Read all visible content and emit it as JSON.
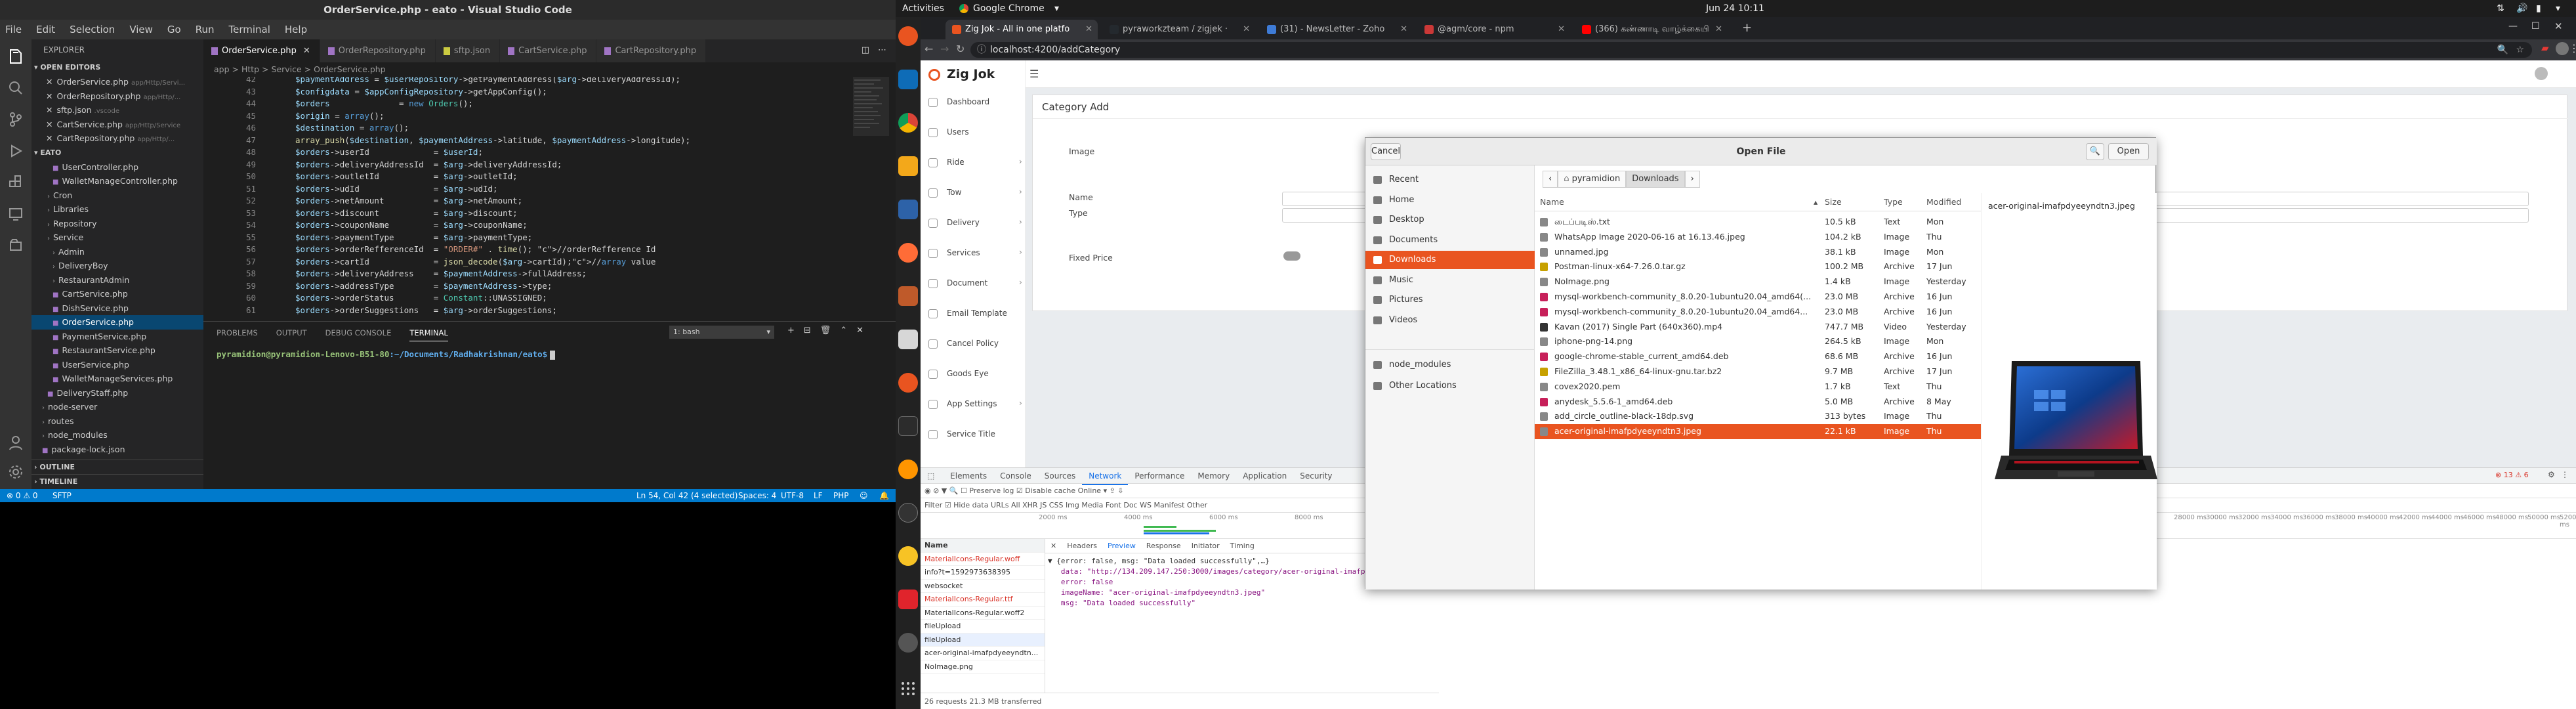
{
  "vscode": {
    "title": "OrderService.php - eato - Visual Studio Code",
    "menu": [
      "File",
      "Edit",
      "Selection",
      "View",
      "Go",
      "Run",
      "Terminal",
      "Help"
    ],
    "explorer_title": "EXPLORER",
    "open_editors_label": "OPEN EDITORS",
    "open_editors": [
      {
        "name": "OrderService.php",
        "path": "app/Http/Servi..."
      },
      {
        "name": "OrderRepository.php",
        "path": "app/Http/..."
      },
      {
        "name": "sftp.json",
        "path": ".vscode"
      },
      {
        "name": "CartService.php",
        "path": "app/Http/Service"
      },
      {
        "name": "CartRepository.php",
        "path": "app/Http/..."
      }
    ],
    "project_label": "EATO",
    "tree": [
      {
        "name": "UserController.php",
        "depth": 3
      },
      {
        "name": "WalletManageController.php",
        "depth": 3
      },
      {
        "name": "Cron",
        "depth": 2
      },
      {
        "name": "Libraries",
        "depth": 2
      },
      {
        "name": "Repository",
        "depth": 2
      },
      {
        "name": "Service",
        "depth": 2
      },
      {
        "name": "Admin",
        "depth": 3
      },
      {
        "name": "DeliveryBoy",
        "depth": 3
      },
      {
        "name": "RestaurantAdmin",
        "depth": 3
      },
      {
        "name": "CartService.php",
        "depth": 3
      },
      {
        "name": "DishService.php",
        "depth": 3
      },
      {
        "name": "OrderService.php",
        "depth": 3,
        "selected": true
      },
      {
        "name": "PaymentService.php",
        "depth": 3
      },
      {
        "name": "RestaurantService.php",
        "depth": 3
      },
      {
        "name": "UserService.php",
        "depth": 3
      },
      {
        "name": "WalletManageServices.php",
        "depth": 3
      },
      {
        "name": "DeliveryStaff.php",
        "depth": 2
      },
      {
        "name": "node-server",
        "depth": 1
      },
      {
        "name": "routes",
        "depth": 1
      },
      {
        "name": "node_modules",
        "depth": 1
      },
      {
        "name": "package-lock.json",
        "depth": 1
      }
    ],
    "outline_label": "OUTLINE",
    "timeline_label": "TIMELINE",
    "tabs": [
      "OrderService.php",
      "OrderRepository.php",
      "sftp.json",
      "CartService.php",
      "CartRepository.php"
    ],
    "breadcrumb": "app > Http > Service > OrderService.php",
    "code_lines": [
      {
        "n": "42",
        "t": "$paymentAddress = $userRepository->getPaymentAddress($arg->deliveryAddressId);"
      },
      {
        "n": "43",
        "t": "$configdata = $appConfigRepository->getAppConfig();"
      },
      {
        "n": "44",
        "t": "$orders              = new Orders();"
      },
      {
        "n": "45",
        "t": "$origin = array();"
      },
      {
        "n": "46",
        "t": "$destination = array();"
      },
      {
        "n": "47",
        "t": "array_push($destination, $paymentAddress->latitude, $paymentAddress->longitude);"
      },
      {
        "n": "48",
        "t": "$orders->userId             = $userId;"
      },
      {
        "n": "49",
        "t": "$orders->deliveryAddressId  = $arg->deliveryAddressId;"
      },
      {
        "n": "50",
        "t": "$orders->outletId           = $arg->outletId;"
      },
      {
        "n": "51",
        "t": "$orders->udId               = $arg->udId;"
      },
      {
        "n": "52",
        "t": "$orders->netAmount          = $arg->netAmount;"
      },
      {
        "n": "53",
        "t": "$orders->discount           = $arg->discount;"
      },
      {
        "n": "54",
        "t": "$orders->couponName         = $arg->couponName;"
      },
      {
        "n": "55",
        "t": "$orders->paymentType        = $arg->paymentType;"
      },
      {
        "n": "56",
        "t": "$orders->orderRefferenceId  = \"ORDER#\" . time(); //orderRefference Id"
      },
      {
        "n": "57",
        "t": "$orders->cartId             = json_decode($arg->cartId);//array value"
      },
      {
        "n": "58",
        "t": "$orders->deliveryAddress    = $paymentAddress->fullAddress;"
      },
      {
        "n": "59",
        "t": "$orders->addressType        = $paymentAddress->type;"
      },
      {
        "n": "60",
        "t": "$orders->orderStatus        = Constant::UNASSIGNED;"
      },
      {
        "n": "61",
        "t": "$orders->orderSuggestions   = $arg->orderSuggestions;"
      }
    ],
    "panel_tabs": [
      "PROBLEMS",
      "OUTPUT",
      "DEBUG CONSOLE",
      "TERMINAL"
    ],
    "terminal_select": "1: bash",
    "terminal_prompt_user": "pyramidion@pyramidion-Lenovo-B51-80",
    "terminal_prompt_path": ":~/Documents/Radhakrishnan/eato$",
    "status_left": [
      "⊗ 0 ⚠ 0",
      "SFTP"
    ],
    "status_right": [
      "Ln 54, Col 42 (4 selected)",
      "Spaces: 4",
      "UTF-8",
      "LF",
      "PHP"
    ]
  },
  "system": {
    "activities": "Activities",
    "app_name": "Google Chrome",
    "clock": "Jun 24  10:11"
  },
  "chrome": {
    "tabs": [
      {
        "title": "Zig Jok - All in one platfo",
        "color": "#e95420",
        "active": true
      },
      {
        "title": "pyraworkzteam / zigjek ·",
        "color": "#24292e"
      },
      {
        "title": "(31) - NewsLetter - Zoho",
        "color": "#3e7bd6"
      },
      {
        "title": "@agm/core - npm",
        "color": "#cb3837"
      },
      {
        "title": "(366) கண்ணாடி வாழ்க்கையி",
        "color": "#ff0000"
      }
    ],
    "url": "localhost:4200/addCategory"
  },
  "app": {
    "logo": "Zig Jok",
    "nav": [
      {
        "label": "Dashboard",
        "chev": false
      },
      {
        "label": "Users",
        "chev": false
      },
      {
        "label": "Ride",
        "chev": true
      },
      {
        "label": "Tow",
        "chev": true
      },
      {
        "label": "Delivery",
        "chev": true
      },
      {
        "label": "Services",
        "chev": true
      },
      {
        "label": "Document",
        "chev": true
      },
      {
        "label": "Email Template",
        "chev": false
      },
      {
        "label": "Cancel Policy",
        "chev": false
      },
      {
        "label": "Goods Eye",
        "chev": false
      },
      {
        "label": "App Settings",
        "chev": true
      },
      {
        "label": "Service Title",
        "chev": false
      }
    ],
    "card_title": "Category Add",
    "labels": [
      "Image",
      "Name",
      "Type",
      "Fixed Price"
    ]
  },
  "devtools": {
    "tabs": [
      "Elements",
      "Console",
      "Sources",
      "Network",
      "Performance",
      "Memory",
      "Application",
      "Security"
    ],
    "toolbar": "◉  ⊘  ▼  🔍   ☐ Preserve log   ☑ Disable cache   Online ▾   ⇪  ⇩",
    "filter": "Filter          ☑ Hide data URLs   All  XHR  JS  CSS  Img  Media  Font  Doc  WS  Manifest  Other",
    "timeline_ticks": [
      "2000 ms",
      "4000 ms",
      "6000 ms",
      "8000 ms",
      "10000 ms"
    ],
    "timeline_ticks_right": [
      "28000 ms",
      "30000 ms",
      "32000 ms",
      "34000 ms",
      "36000 ms",
      "38000 ms",
      "40000 ms",
      "42000 ms",
      "44000 ms",
      "46000 ms",
      "48000 ms",
      "50000 ms",
      "52000 ms"
    ],
    "names_header": "Name",
    "names": [
      {
        "n": "MaterialIcons-Regular.woff",
        "red": true
      },
      {
        "n": "info?t=1592973638395",
        "red": false
      },
      {
        "n": "websocket",
        "red": false
      },
      {
        "n": "MaterialIcons-Regular.ttf",
        "red": true
      },
      {
        "n": "MaterialIcons-Regular.woff2",
        "red": false
      },
      {
        "n": "fileUpload",
        "red": false
      },
      {
        "n": "fileUpload",
        "red": false,
        "sel": true
      },
      {
        "n": "acer-original-imafpdyeeyndtn...",
        "red": false
      },
      {
        "n": "NoImage.png",
        "red": false
      }
    ],
    "detail_tabs": [
      "Headers",
      "Preview",
      "Response",
      "Initiator",
      "Timing"
    ],
    "json_lines": [
      "▼ {error: false, msg: \"Data loaded successfully\",…}",
      "   data: \"http://134.209.147.250:3000/images/category/acer-original-imafpdyeeyndtn3.jpeg\"",
      "   error: false",
      "   imageName: \"acer-original-imafpdyeeyndtn3.jpeg\"",
      "   msg: \"Data loaded successfully\""
    ],
    "footer": "26 requests   21.3 MB transferred",
    "errors": "⊗ 13  ⚠ 6"
  },
  "dialog": {
    "title": "Open File",
    "cancel": "Cancel",
    "open": "Open",
    "places": [
      {
        "label": "Recent",
        "icon": "clock-icon"
      },
      {
        "label": "Home",
        "icon": "home-icon"
      },
      {
        "label": "Desktop",
        "icon": "desktop-icon"
      },
      {
        "label": "Documents",
        "icon": "documents-icon"
      },
      {
        "label": "Downloads",
        "icon": "downloads-icon",
        "sel": true
      },
      {
        "label": "Music",
        "icon": "music-icon"
      },
      {
        "label": "Pictures",
        "icon": "pictures-icon"
      },
      {
        "label": "Videos",
        "icon": "videos-icon"
      },
      {
        "label": "node_modules",
        "icon": "folder-icon"
      },
      {
        "label": "Other Locations",
        "icon": "plus-icon"
      }
    ],
    "path": [
      "pyramidion",
      "Downloads"
    ],
    "columns": {
      "name": "Name",
      "size": "Size",
      "type": "Type",
      "modified": "Modified"
    },
    "files": [
      {
        "name": "டைப்படிஸ்.txt",
        "size": "10.5 kB",
        "type": "Text",
        "mod": "Mon",
        "color": "#888"
      },
      {
        "name": "WhatsApp Image 2020-06-16 at 16.13.46.jpeg",
        "size": "104.2 kB",
        "type": "Image",
        "mod": "Thu",
        "color": "#888"
      },
      {
        "name": "unnamed.jpg",
        "size": "38.1 kB",
        "type": "Image",
        "mod": "Mon",
        "color": "#888"
      },
      {
        "name": "Postman-linux-x64-7.26.0.tar.gz",
        "size": "100.2 MB",
        "type": "Archive",
        "mod": "17 Jun",
        "color": "#c7a100"
      },
      {
        "name": "NoImage.png",
        "size": "1.4 kB",
        "type": "Image",
        "mod": "Yesterday",
        "color": "#888"
      },
      {
        "name": "mysql-workbench-community_8.0.20-1ubuntu20.04_amd64(...",
        "size": "23.0 MB",
        "type": "Archive",
        "mod": "16 Jun",
        "color": "#c7205a"
      },
      {
        "name": "mysql-workbench-community_8.0.20-1ubuntu20.04_amd64...",
        "size": "23.0 MB",
        "type": "Archive",
        "mod": "16 Jun",
        "color": "#c7205a"
      },
      {
        "name": "Kavan (2017) Single Part (640x360).mp4",
        "size": "747.7 MB",
        "type": "Video",
        "mod": "Yesterday",
        "color": "#333"
      },
      {
        "name": "iphone-png-14.png",
        "size": "264.5 kB",
        "type": "Image",
        "mod": "Mon",
        "color": "#888"
      },
      {
        "name": "google-chrome-stable_current_amd64.deb",
        "size": "68.6 MB",
        "type": "Archive",
        "mod": "16 Jun",
        "color": "#c7205a"
      },
      {
        "name": "FileZilla_3.48.1_x86_64-linux-gnu.tar.bz2",
        "size": "9.7 MB",
        "type": "Archive",
        "mod": "17 Jun",
        "color": "#c7a100"
      },
      {
        "name": "covex2020.pem",
        "size": "1.7 kB",
        "type": "Text",
        "mod": "Thu",
        "color": "#888"
      },
      {
        "name": "anydesk_5.5.6-1_amd64.deb",
        "size": "5.0 MB",
        "type": "Archive",
        "mod": "8 May",
        "color": "#c7205a"
      },
      {
        "name": "add_circle_outline-black-18dp.svg",
        "size": "313 bytes",
        "type": "Image",
        "mod": "Thu",
        "color": "#888"
      },
      {
        "name": "acer-original-imafpdyeeyndtn3.jpeg",
        "size": "22.1 kB",
        "type": "Image",
        "mod": "Thu",
        "color": "#888",
        "sel": true
      }
    ],
    "preview_name": "acer-original-imafpdyeeyndtn3.jpeg"
  },
  "colors": {
    "vs_status": "#007acc",
    "ubuntu_orange": "#e95420",
    "chrome_dark": "#202124"
  }
}
